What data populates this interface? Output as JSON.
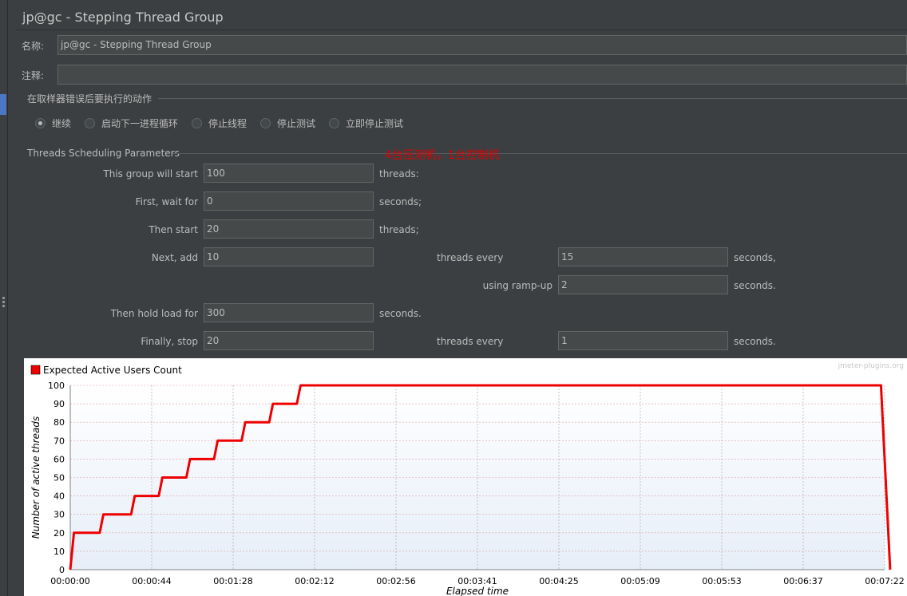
{
  "header": {
    "title": "jp@gc - Stepping Thread Group"
  },
  "form": {
    "name_label": "名称:",
    "name_value": "jp@gc - Stepping Thread Group",
    "comment_label": "注释:",
    "comment_value": ""
  },
  "error_action": {
    "section_title": "在取样器错误后要执行的动作",
    "options": [
      "继续",
      "启动下一进程循环",
      "停止线程",
      "停止测试",
      "立即停止测试"
    ],
    "selected": "继续"
  },
  "params": {
    "section_title": "Threads Scheduling Parameters",
    "annotation": "4台压测机，1台控制机",
    "start_label": "This group will start",
    "start_value": "100",
    "start_unit": "threads:",
    "wait_label": "First, wait for",
    "wait_value": "0",
    "wait_unit": "seconds;",
    "then_start_label": "Then start",
    "then_start_value": "20",
    "then_start_unit": "threads;",
    "next_add_label": "Next, add",
    "next_add_value": "10",
    "threads_every_label": "threads every",
    "threads_every_value": "15",
    "threads_every_unit": "seconds,",
    "ramp_label": "using ramp-up",
    "ramp_value": "2",
    "ramp_unit": "seconds.",
    "hold_label": "Then hold load for",
    "hold_value": "300",
    "hold_unit": "seconds.",
    "stop_label": "Finally, stop",
    "stop_value": "20",
    "stop_every_label": "threads every",
    "stop_every_value": "1",
    "stop_every_unit": "seconds."
  },
  "colors": {
    "series": "#ee0000",
    "grid": "#c0c0c0",
    "background": "#3c3f41"
  },
  "chart_data": {
    "type": "line",
    "title": "",
    "watermark": "jmeter-plugins.org",
    "xlabel": "Elapsed time",
    "ylabel": "Number of active threads",
    "ylim": [
      0,
      100
    ],
    "xlim_seconds": [
      0,
      442
    ],
    "yticks": [
      0,
      10,
      20,
      30,
      40,
      50,
      60,
      70,
      80,
      90,
      100
    ],
    "xticks": [
      "00:00:00",
      "00:00:44",
      "00:01:28",
      "00:02:12",
      "00:02:56",
      "00:03:41",
      "00:04:25",
      "00:05:09",
      "00:05:53",
      "00:06:37",
      "00:07:22"
    ],
    "legend_position": "top-left",
    "grid": true,
    "series": [
      {
        "name": "Expected Active Users Count",
        "points": [
          [
            0,
            0
          ],
          [
            2,
            20
          ],
          [
            16,
            20
          ],
          [
            18,
            30
          ],
          [
            33,
            30
          ],
          [
            35,
            40
          ],
          [
            48,
            40
          ],
          [
            50,
            50
          ],
          [
            63,
            50
          ],
          [
            65,
            60
          ],
          [
            78,
            60
          ],
          [
            80,
            70
          ],
          [
            93,
            70
          ],
          [
            95,
            80
          ],
          [
            108,
            80
          ],
          [
            110,
            90
          ],
          [
            123,
            90
          ],
          [
            125,
            100
          ],
          [
            440,
            100
          ],
          [
            441,
            80
          ],
          [
            442,
            60
          ],
          [
            443,
            40
          ],
          [
            444,
            20
          ],
          [
            445,
            0
          ]
        ]
      }
    ]
  }
}
